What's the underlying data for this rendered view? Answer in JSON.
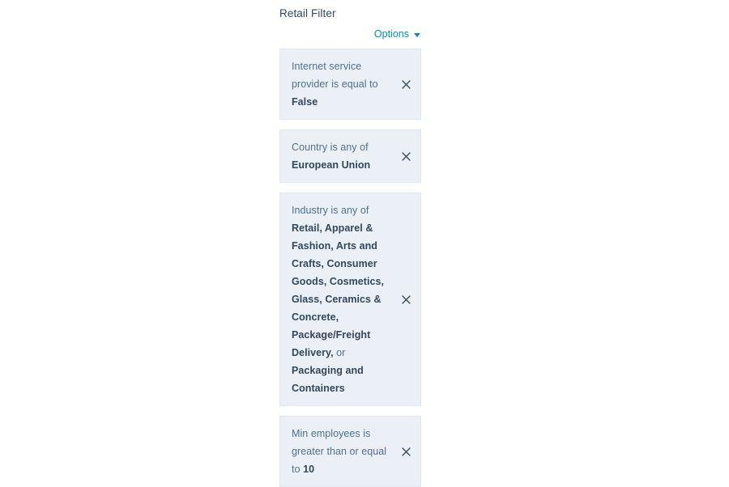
{
  "panel": {
    "title": "Retail Filter",
    "options_label": "Options",
    "caret_icon": "chevron-down-icon",
    "remove_icon": "close-icon",
    "accent_color": "#0091ae",
    "card_background": "#eaf0f6",
    "card_border": "#dfe7ef",
    "text_color": "#516f90",
    "value_color": "#33475b"
  },
  "filters": [
    {
      "property": "Internet service provider",
      "operator": "is equal to",
      "value": "False",
      "parts": [
        {
          "text": "Internet service provider is equal to ",
          "bold": false
        },
        {
          "text": "False",
          "bold": true
        }
      ]
    },
    {
      "property": "Country",
      "operator": "is any of",
      "value": "European Union",
      "parts": [
        {
          "text": "Country is any of ",
          "bold": false
        },
        {
          "text": "European Union",
          "bold": true
        }
      ]
    },
    {
      "property": "Industry",
      "operator": "is any of",
      "value": "Retail, Apparel & Fashion, Arts and Crafts, Consumer Goods, Cosmetics, Glass, Ceramics & Concrete, Package/Freight Delivery, or Packaging and Containers",
      "parts": [
        {
          "text": "Industry is any of ",
          "bold": false
        },
        {
          "text": "Retail, Apparel & Fashion, Arts and Crafts, Consumer Goods, Cosmetics, Glass, Ceramics & Concrete, Package/Freight Delivery,",
          "bold": true
        },
        {
          "text": " or ",
          "bold": false
        },
        {
          "text": "Packaging and Containers",
          "bold": true
        }
      ]
    },
    {
      "property": "Min employees",
      "operator": "is greater than or equal to",
      "value": "10",
      "parts": [
        {
          "text": "Min employees is greater than or equal to ",
          "bold": false
        },
        {
          "text": "10",
          "bold": true
        }
      ]
    }
  ]
}
